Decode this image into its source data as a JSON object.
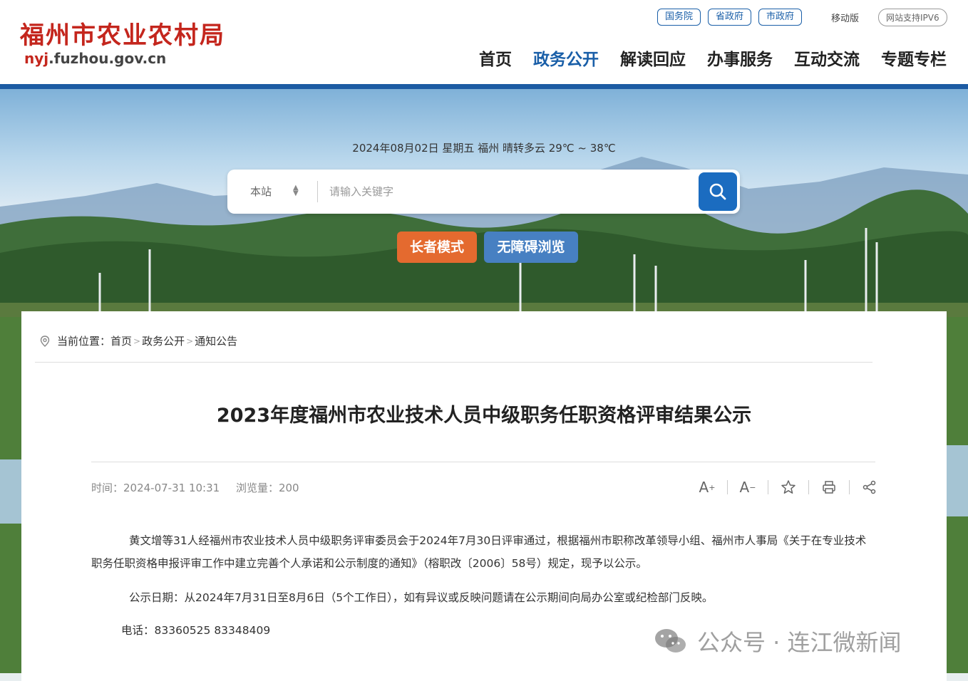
{
  "site": {
    "name": "福州市农业农村局",
    "url_prefix": "nyj",
    "url_suffix": ".fuzhou.gov.cn"
  },
  "top_links": [
    "国务院",
    "省政府",
    "市政府"
  ],
  "mobile_label": "移动版",
  "ipv6_label": "网站支持IPV6",
  "nav": [
    "首页",
    "政务公开",
    "解读回应",
    "办事服务",
    "互动交流",
    "专题专栏"
  ],
  "nav_active": "政务公开",
  "weather": "2024年08月02日  星期五  福州  晴转多云  29℃ ~ 38℃",
  "search": {
    "scope": "本站",
    "placeholder": "请输入关键字"
  },
  "modes": {
    "elder": "长者模式",
    "accessible": "无障碍浏览"
  },
  "breadcrumb": {
    "prefix": "当前位置：",
    "items": [
      "首页",
      "政务公开",
      "通知公告"
    ]
  },
  "article": {
    "title": "2023年度福州市农业技术人员中级职务任职资格评审结果公示",
    "time": "时间：2024-07-31 10:31",
    "views": "浏览量：200",
    "p1": "黄文增等31人经福州市农业技术人员中级职务评审委员会于2024年7月30日评审通过，根据福州市职称改革领导小组、福州市人事局《关于在专业技术职务任职资格申报评审工作中建立完善个人承诺和公示制度的通知》（榕职改〔2006〕58号）规定，现予以公示。",
    "p2": "公示日期：从2024年7月31日至8月6日（5个工作日），如有异议或反映问题请在公示期间向局办公室或纪检部门反映。",
    "p3": "电话：83360525  83348409"
  },
  "watermark": "公众号 · 连江微新闻",
  "colors": {
    "brand_red": "#c4261d",
    "brand_blue": "#1c5ba3",
    "elder_orange": "#e46a2f",
    "access_blue": "#4780c2"
  }
}
